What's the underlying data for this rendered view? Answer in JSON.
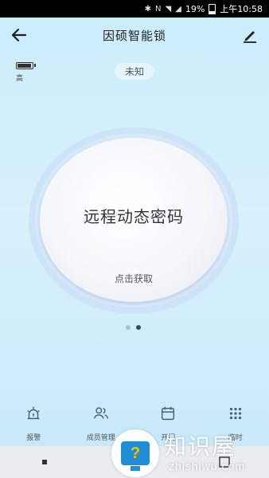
{
  "status_bar": {
    "battery_percent": "19%",
    "time": "上午10:58"
  },
  "header": {
    "title": "因硕智能锁",
    "back_icon": "arrow-left-icon",
    "edit_icon": "pencil-icon"
  },
  "lock_battery": {
    "level_label": "高",
    "fill_fraction": 0.85
  },
  "lock_status": "未知",
  "main_action": {
    "label": "远程动态密码",
    "sub_label": "点击获取"
  },
  "pager": {
    "pages": 2,
    "active": 2
  },
  "bottom_nav": [
    {
      "label": "报警",
      "icon": "alarm-light-icon"
    },
    {
      "label": "成员管理",
      "icon": "users-icon"
    },
    {
      "label": "开门",
      "icon": "calendar-icon"
    },
    {
      "label": "临时",
      "icon": "keypad-icon"
    }
  ],
  "system_nav": [
    "recent-apps-icon",
    "back-triangle-icon",
    "home-icon"
  ],
  "watermark": {
    "title": "知识屋",
    "url": "zhishiwu.com",
    "logo_glyph": "?"
  },
  "colors": {
    "background_top": "#c9ecfb",
    "background_bottom": "#c6e8fa",
    "accent_blue": "#1e8fd6",
    "logo_yellow": "#f5c400"
  }
}
